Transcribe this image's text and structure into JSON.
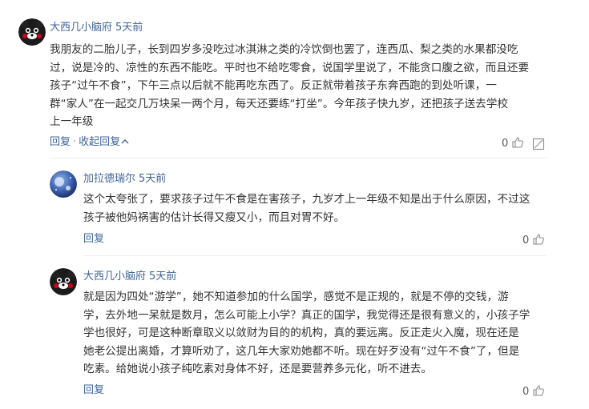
{
  "comments": [
    {
      "author": "大西几小脑府",
      "time": "5天前",
      "lines": [
        "我朋友的二胎儿子，长到四岁多没吃过冰淇淋之类的冷饮倒也罢了，连西瓜、梨之类的水果都没吃",
        "过，说是冷的、凉性的东西不能吃。平时也不给吃零食，说国学里说了，不能贪口腹之欲，而且还要",
        "孩子“过午不食”，下午三点以后就不能再吃东西了。反正就带着孩子东奔西跑的到处听课，一",
        "群“家人”在一起交几万块呆一两个月，每天还要练“打坐”。今年孩子快九岁，还把孩子送去学校",
        "上一年级"
      ],
      "reply_label": "回复",
      "separator": "·",
      "collapse_label": "收起回复",
      "likes": "0"
    },
    {
      "author": "加拉德瑞尔",
      "time": "5天前",
      "lines": [
        "这个太夸张了，要求孩子过午不食是在害孩子，九岁才上一年级不知是出于什么原因，不过这",
        "孩子被他妈祸害的估计长得又瘦又小，而且对胃不好。"
      ],
      "reply_label": "回复",
      "likes": "0"
    },
    {
      "author": "大西几小脑府",
      "time": "5天前",
      "lines": [
        "就是因为四处“游学”，她不知道参加的什么国学，感觉不是正规的，就是不停的交钱，游",
        "学，去外地一呆就是数月，怎么可能上小学？真正的国学，我觉得还是很有意义的，小孩子学",
        "学也很好，可是这种断章取义以敛财为目的的机构，真的要远离。反正走火入魔，现在还是",
        "她老公提出离婚，才算听劝了，这几年大家劝她都不听。现在好歹没有“过午不食”了，但是",
        "吃素。给她说小孩子纯吃素对身体不好，还是要营养多元化，听不进去。"
      ],
      "reply_label": "回复",
      "likes": "0"
    }
  ],
  "colors": {
    "link": "#406599",
    "text": "#333333",
    "muted": "#999999"
  },
  "icons": {
    "like": "thumbs-up-icon",
    "report": "report-icon",
    "collapse": "chevron-up-icon"
  }
}
